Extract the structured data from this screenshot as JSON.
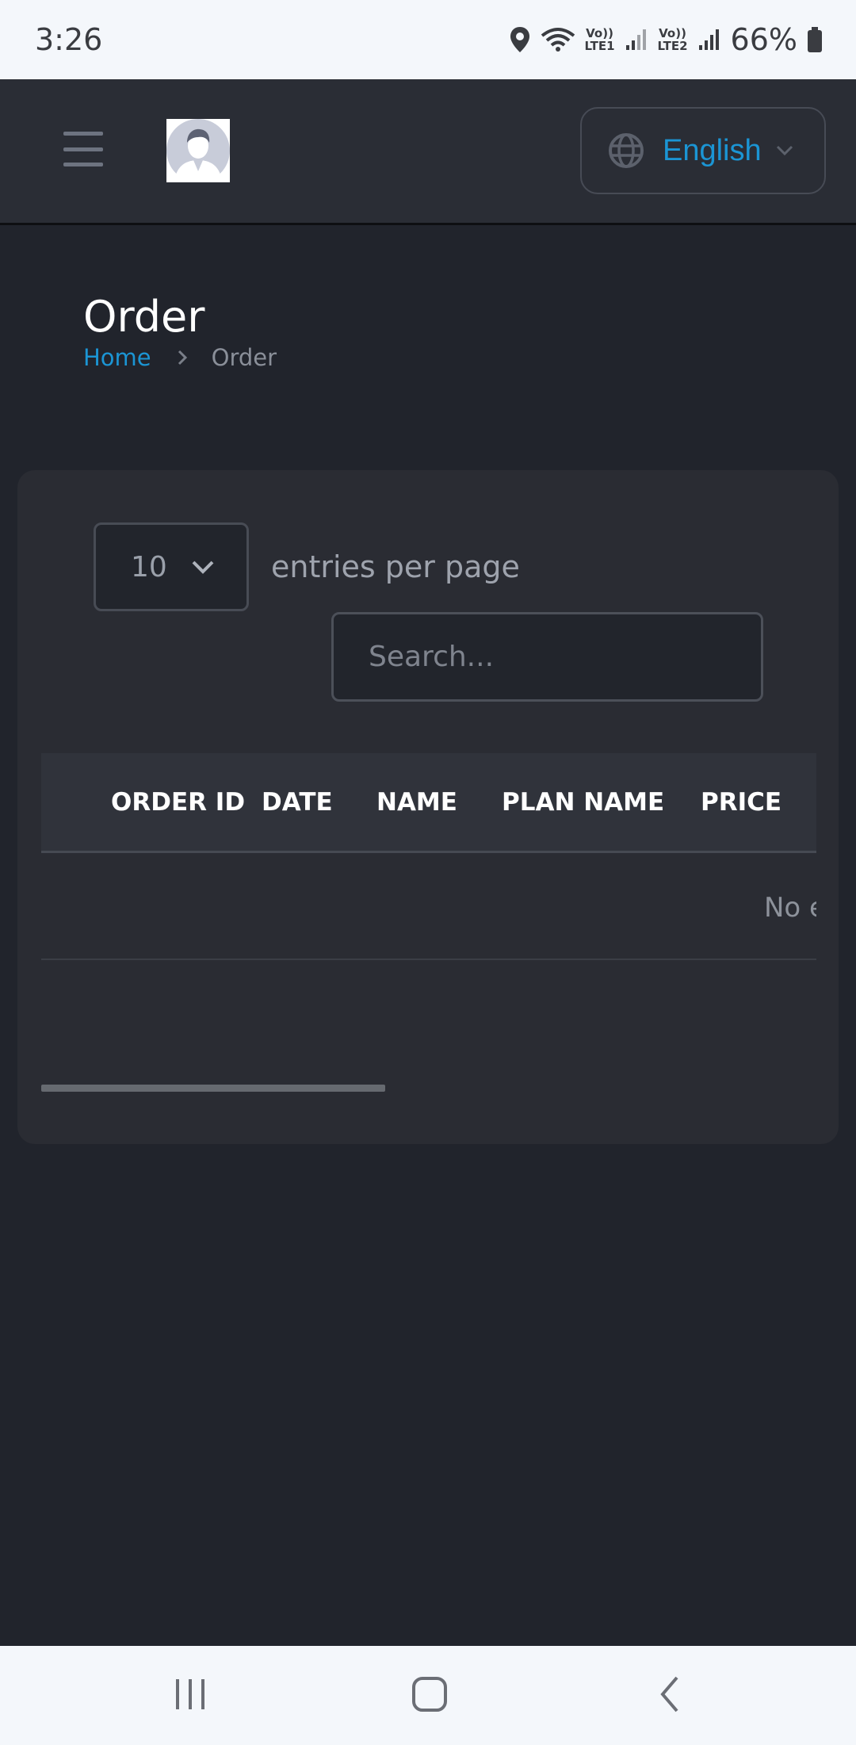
{
  "status_bar": {
    "time": "3:26",
    "sim1": "Vo)) LTE1",
    "sim2": "Vo)) LTE2",
    "battery": "66%",
    "icons": [
      "location-icon",
      "wifi-icon",
      "signal-icon",
      "signal-icon",
      "battery-icon"
    ]
  },
  "header": {
    "menu_icon": "hamburger-icon",
    "avatar_icon": "user-avatar",
    "language": {
      "icon": "globe-icon",
      "label": "English"
    },
    "accent_color": "#1b95d4"
  },
  "page": {
    "title": "Order",
    "breadcrumb": {
      "home": "Home",
      "current": "Order"
    }
  },
  "table_controls": {
    "entries_value": "10",
    "entries_label": "entries per page",
    "search_placeholder": "Search..."
  },
  "table": {
    "columns": [
      "ORDER ID",
      "DATE",
      "NAME",
      "PLAN NAME",
      "PRICE"
    ],
    "empty_text": "No er"
  },
  "nav_bar": {
    "buttons": [
      "recents-icon",
      "home-icon",
      "back-icon"
    ]
  }
}
